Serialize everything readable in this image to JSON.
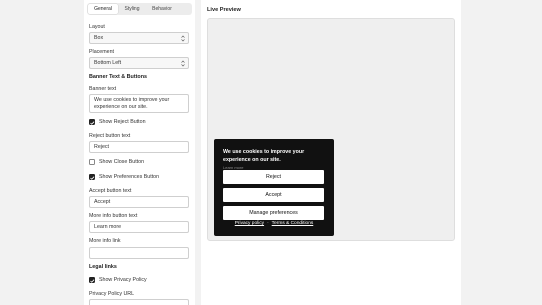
{
  "tabs": [
    {
      "label": "General",
      "active": true
    },
    {
      "label": "Styling",
      "active": false
    },
    {
      "label": "Behavior",
      "active": false
    }
  ],
  "settings": {
    "layout_label": "Layout",
    "layout_value": "Box",
    "placement_label": "Placement",
    "placement_value": "Bottom Left",
    "banner_section": "Banner Text & Buttons",
    "banner_text_label": "Banner text",
    "banner_text_value": "We use cookies to improve your experience on our site.",
    "show_reject_label": "Show Reject Button",
    "show_reject_checked": true,
    "reject_label": "Reject button text",
    "reject_value": "Reject",
    "show_close_label": "Show Close Button",
    "show_close_checked": false,
    "show_prefs_label": "Show Preferences Button",
    "show_prefs_checked": true,
    "accept_label": "Accept button text",
    "accept_value": "Accept",
    "more_info_label": "More info button text",
    "more_info_value": "Learn more",
    "more_info_link_label": "More info link",
    "more_info_link_value": "",
    "legal_section": "Legal links",
    "show_privacy_label": "Show Privacy Policy",
    "show_privacy_checked": true,
    "privacy_url_label": "Privacy Policy URL"
  },
  "preview": {
    "title": "Live Preview",
    "banner": {
      "text": "We use cookies to improve your experience on our site.",
      "learn_more": "Learn more",
      "reject": "Reject",
      "accept": "Accept",
      "manage": "Manage preferences",
      "privacy": "Privacy policy",
      "separator": "·",
      "terms": "Terms & Conditions"
    }
  },
  "colors": {
    "banner_bg": "#111111",
    "banner_button_bg": "#ffffff",
    "canvas_bg": "#efefef",
    "page_bg": "#f2f2f2"
  }
}
